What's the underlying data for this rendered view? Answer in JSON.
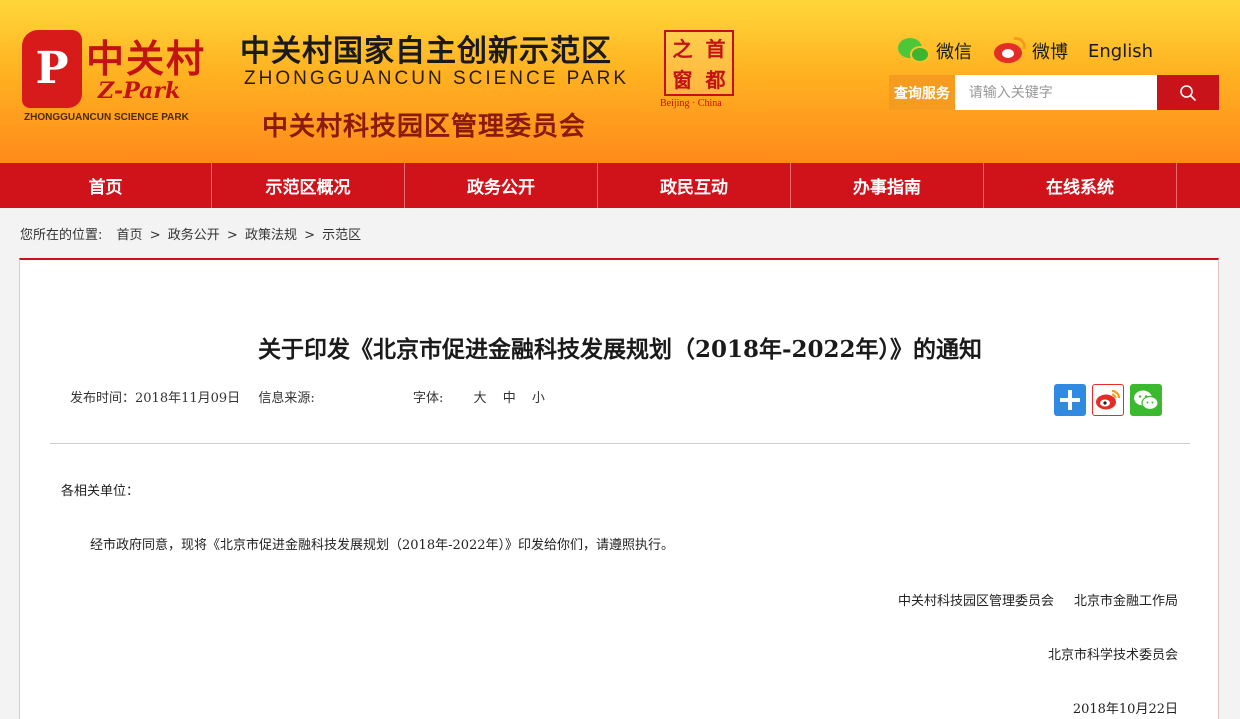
{
  "header": {
    "logo": {
      "cn": "中关村",
      "en": "Z-Park",
      "sub": "ZHONGGUANCUN SCIENCE PARK",
      "mark_letter": "P"
    },
    "title": "中关村国家自主创新示范区",
    "title_en": "ZHONGGUANCUN SCIENCE PARK",
    "subtitle": "中关村科技园区管理委员会",
    "seal": {
      "chars": [
        "之",
        "首",
        "窗",
        "都"
      ],
      "caption": "Beijing · China"
    },
    "social": {
      "wechat": "微信",
      "weibo": "微博",
      "english": "English"
    },
    "search": {
      "label": "查询服务",
      "placeholder": "请输入关键字"
    }
  },
  "nav": {
    "items": [
      "首页",
      "示范区概况",
      "政务公开",
      "政民互动",
      "办事指南",
      "在线系统"
    ]
  },
  "breadcrumb": {
    "label": "您所在的位置:",
    "items": [
      "首页",
      "政务公开",
      "政策法规",
      "示范区"
    ],
    "separator": ">"
  },
  "article": {
    "title": "关于印发《北京市促进金融科技发展规划（2018年-2022年）》的通知",
    "publish_time": "发布时间：2018年11月09日",
    "source": "信息来源:",
    "font_label": "字体:",
    "font_sizes": [
      "大",
      "中",
      "小"
    ],
    "salutation": "各相关单位：",
    "paragraph": "经市政府同意，现将《北京市促进金融科技发展规划（2018年-2022年）》印发给你们，请遵照执行。",
    "signatories_1": [
      "中关村科技园区管理委员会",
      "北京市金融工作局"
    ],
    "signatories_2": "北京市科学技术委员会",
    "date": "2018年10月22日"
  },
  "colors": {
    "nav_red": "#d0121b",
    "search_orange": "#f59b1f",
    "search_button": "#c8131b",
    "header_top": "#ffd63a",
    "header_bottom": "#ff8a1a"
  }
}
